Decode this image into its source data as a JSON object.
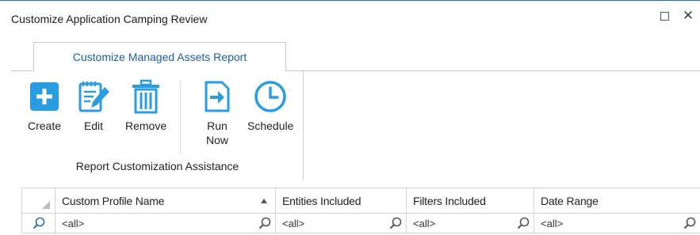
{
  "window": {
    "title": "Customize Application Camping Review",
    "maximize_icon": "maximize-icon",
    "close_icon": "close-icon",
    "close_glyph": "✕"
  },
  "tabs": [
    {
      "label": "Customize Managed Assets Report",
      "active": true
    }
  ],
  "ribbon": {
    "group_caption": "Report Customization Assistance",
    "buttons": {
      "create": {
        "label": "Create",
        "icon": "plus-icon"
      },
      "edit": {
        "label": "Edit",
        "icon": "notepad-pencil-icon"
      },
      "remove": {
        "label": "Remove",
        "icon": "trash-icon"
      },
      "run_now": {
        "label_line1": "Run",
        "label_line2": "Now",
        "icon": "run-document-icon"
      },
      "schedule": {
        "label": "Schedule",
        "icon": "clock-icon"
      }
    }
  },
  "grid": {
    "columns": [
      {
        "label": "Custom Profile Name",
        "sorted": "ascending"
      },
      {
        "label": "Entities Included"
      },
      {
        "label": "Filters Included"
      },
      {
        "label": "Date Range"
      }
    ],
    "filter_row": {
      "values": [
        "<all>",
        "<all>",
        "<all>",
        "<all>"
      ],
      "icon": "search-icon"
    }
  },
  "colors": {
    "accent": "#2a9de0",
    "tab_text": "#1c5fa8",
    "icon_gray": "#555555"
  }
}
